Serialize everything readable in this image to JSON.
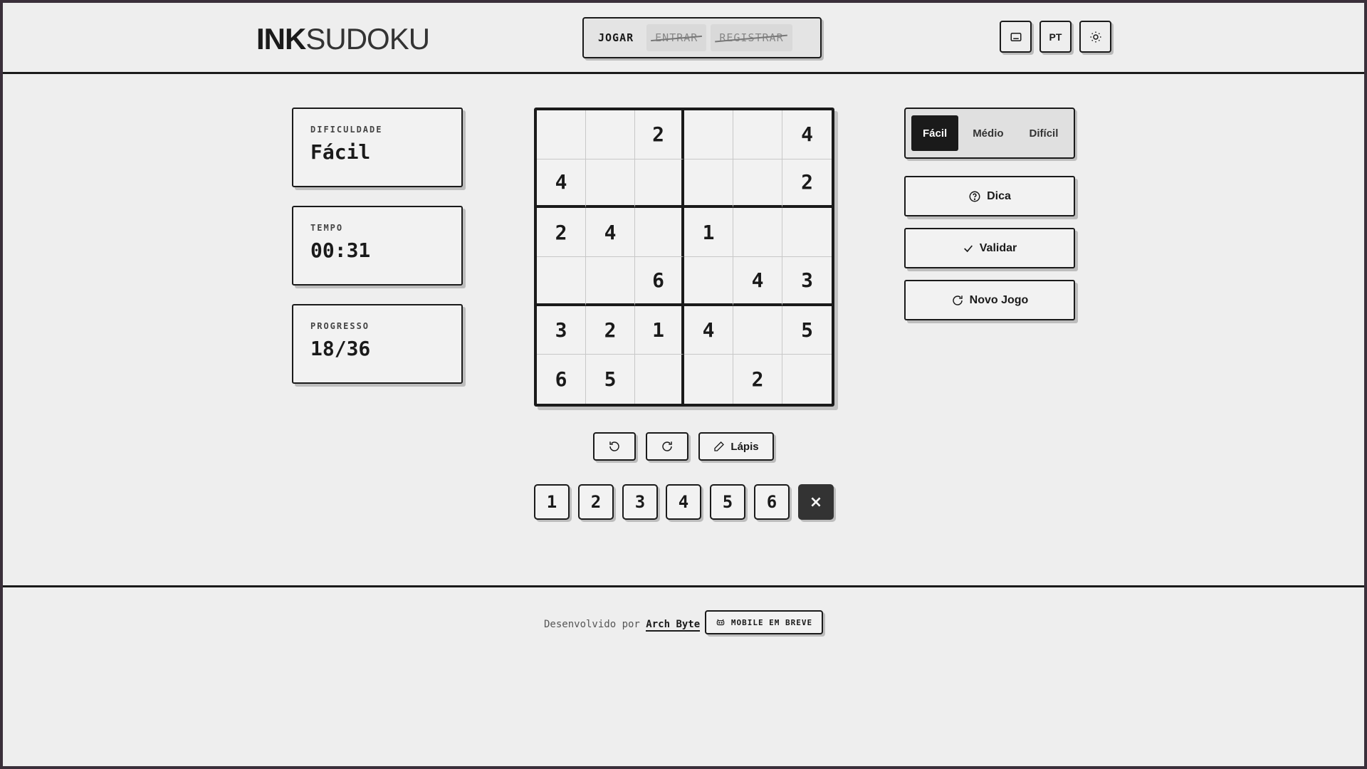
{
  "header": {
    "logo_bold": "INK",
    "logo_light": "SUDOKU",
    "nav": {
      "play": "JOGAR",
      "login": "ENTRAR",
      "register": "REGISTRAR"
    },
    "lang": "PT"
  },
  "stats": {
    "difficulty_label": "DIFICULDADE",
    "difficulty_value": "Fácil",
    "time_label": "TEMPO",
    "time_value": "00:31",
    "progress_label": "PROGRESSO",
    "progress_value": "18/36"
  },
  "board": {
    "cells": [
      [
        "",
        "",
        "2",
        "",
        "",
        "4"
      ],
      [
        "4",
        "",
        "",
        "",
        "",
        "2"
      ],
      [
        "2",
        "4",
        "",
        "1",
        "",
        ""
      ],
      [
        "",
        "",
        "6",
        "",
        "4",
        "3"
      ],
      [
        "3",
        "2",
        "1",
        "4",
        "",
        "5"
      ],
      [
        "6",
        "5",
        "",
        "",
        "2",
        ""
      ]
    ]
  },
  "tools": {
    "pencil": "Lápis",
    "undo_icon": "undo-icon",
    "redo_icon": "redo-icon"
  },
  "numpad": {
    "keys": [
      "1",
      "2",
      "3",
      "4",
      "5",
      "6"
    ],
    "erase": "×"
  },
  "difficulty_selector": {
    "easy": "Fácil",
    "medium": "Médio",
    "hard": "Difícil",
    "selected": "Fácil"
  },
  "actions": {
    "hint": "Dica",
    "validate": "Validar",
    "new_game": "Novo Jogo"
  },
  "footer": {
    "credit_prefix": "Desenvolvido por",
    "credit_link": "Arch Byte",
    "mobile": "MOBILE EM BREVE"
  },
  "colors": {
    "background": "#eeeeee",
    "ink": "#1a1a1a",
    "frame": "#3a2f3a",
    "erase_key": "#333333"
  }
}
